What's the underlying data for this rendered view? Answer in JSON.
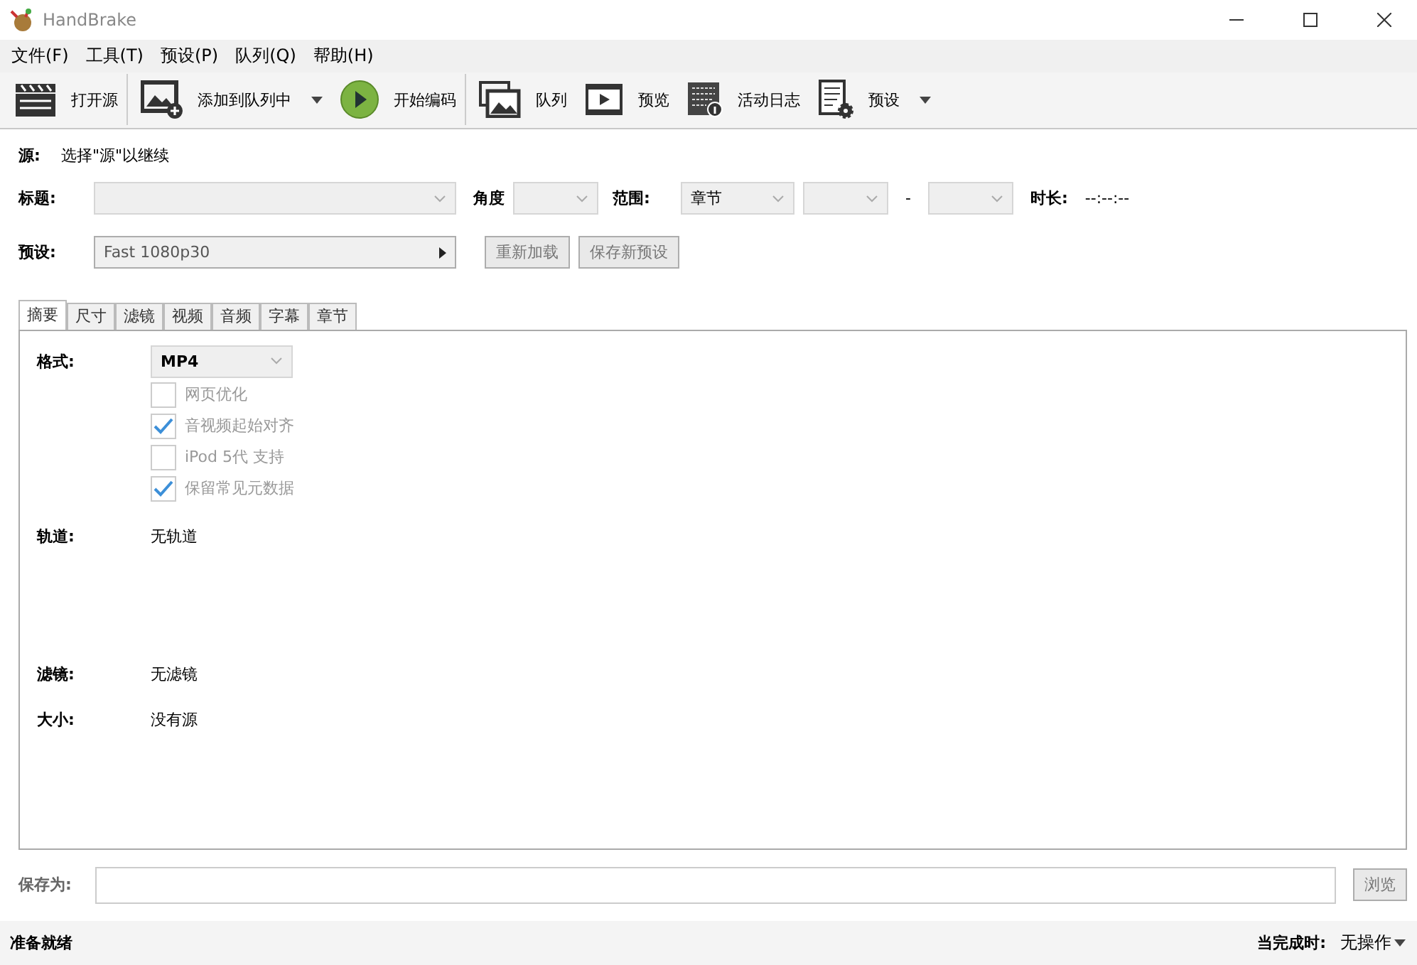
{
  "window": {
    "title": "HandBrake"
  },
  "menu": [
    "文件(F)",
    "工具(T)",
    "预设(P)",
    "队列(Q)",
    "帮助(H)"
  ],
  "toolbar": [
    {
      "kind": "open",
      "label": "打开源",
      "dropdown": false,
      "separator_after": true
    },
    {
      "kind": "add",
      "label": "添加到队列中",
      "dropdown": true,
      "separator_after": false
    },
    {
      "kind": "start",
      "label": "开始编码",
      "dropdown": false,
      "separator_after": true
    },
    {
      "kind": "queue",
      "label": "队列",
      "dropdown": false,
      "separator_after": false
    },
    {
      "kind": "preview",
      "label": "预览",
      "dropdown": false,
      "separator_after": false
    },
    {
      "kind": "log",
      "label": "活动日志",
      "dropdown": false,
      "separator_after": false
    },
    {
      "kind": "presets",
      "label": "预设",
      "dropdown": true,
      "separator_after": false
    }
  ],
  "source": {
    "label": "源:",
    "value": "选择\"源\"以继续"
  },
  "title_row": {
    "title_label": "标题:",
    "angle_label": "角度",
    "range_label": "范围:",
    "range_value": "章节",
    "range_dash": "-",
    "duration_label": "时长:",
    "duration_value": "--:--:--"
  },
  "preset_row": {
    "label": "预设:",
    "value": "Fast 1080p30",
    "buttons": [
      "重新加载",
      "保存新预设"
    ]
  },
  "tabs": [
    {
      "label": "摘要",
      "selected": true
    },
    {
      "label": "尺寸",
      "selected": false
    },
    {
      "label": "滤镜",
      "selected": false
    },
    {
      "label": "视频",
      "selected": false
    },
    {
      "label": "音频",
      "selected": false
    },
    {
      "label": "字幕",
      "selected": false
    },
    {
      "label": "章节",
      "selected": false
    }
  ],
  "summary": {
    "format_label": "格式:",
    "format_value": "MP4",
    "options": [
      {
        "label": "网页优化",
        "checked": false,
        "disabled": true
      },
      {
        "label": "音视频起始对齐",
        "checked": true,
        "disabled": true
      },
      {
        "label": "iPod 5代 支持",
        "checked": false,
        "disabled": true
      },
      {
        "label": "保留常见元数据",
        "checked": true,
        "disabled": true
      }
    ],
    "tracks_label": "轨道:",
    "tracks_value": "无轨道",
    "filters_label": "滤镜:",
    "filters_value": "无滤镜",
    "size_label": "大小:",
    "size_value": "没有源"
  },
  "save_as": {
    "label": "保存为:",
    "browse": "浏览"
  },
  "status_bar": {
    "text": "准备就绪",
    "when_done_label": "当完成时:",
    "when_done_value": "无操作"
  }
}
